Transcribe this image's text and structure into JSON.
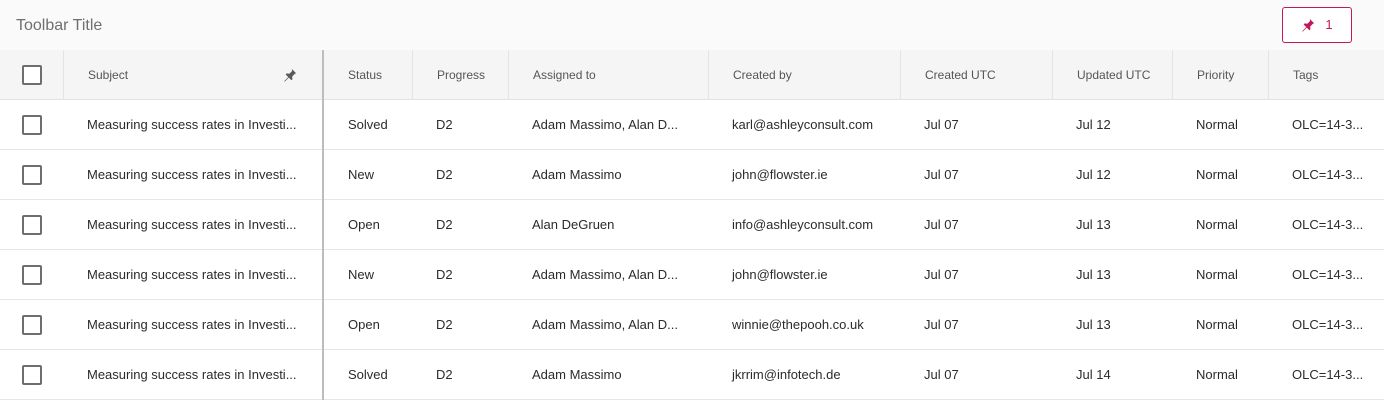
{
  "toolbar": {
    "title": "Toolbar Title",
    "pinned_count": "1",
    "accent_color": "#c2185b",
    "pin_icon": "pin-icon"
  },
  "columns": {
    "subject": "Subject",
    "status": "Status",
    "progress": "Progress",
    "assigned_to": "Assigned to",
    "created_by": "Created by",
    "created_utc": "Created UTC",
    "updated_utc": "Updated UTC",
    "priority": "Priority",
    "tags": "Tags"
  },
  "rows": [
    {
      "subject": "Measuring success rates in Investi...",
      "status": "Solved",
      "progress": "D2",
      "assigned_to": "Adam Massimo, Alan D...",
      "created_by": "karl@ashleyconsult.com",
      "created_utc": "Jul 07",
      "updated_utc": "Jul 12",
      "priority": "Normal",
      "tags": "OLC=14-3..."
    },
    {
      "subject": "Measuring success rates in Investi...",
      "status": "New",
      "progress": "D2",
      "assigned_to": "Adam Massimo",
      "created_by": "john@flowster.ie",
      "created_utc": "Jul 07",
      "updated_utc": "Jul 12",
      "priority": "Normal",
      "tags": "OLC=14-3..."
    },
    {
      "subject": "Measuring success rates in Investi...",
      "status": "Open",
      "progress": "D2",
      "assigned_to": "Alan DeGruen",
      "created_by": "info@ashleyconsult.com",
      "created_utc": "Jul 07",
      "updated_utc": "Jul 13",
      "priority": "Normal",
      "tags": "OLC=14-3..."
    },
    {
      "subject": "Measuring success rates in Investi...",
      "status": "New",
      "progress": "D2",
      "assigned_to": "Adam Massimo, Alan D...",
      "created_by": "john@flowster.ie",
      "created_utc": "Jul 07",
      "updated_utc": "Jul 13",
      "priority": "Normal",
      "tags": "OLC=14-3..."
    },
    {
      "subject": "Measuring success rates in Investi...",
      "status": "Open",
      "progress": "D2",
      "assigned_to": "Adam Massimo, Alan D...",
      "created_by": "winnie@thepooh.co.uk",
      "created_utc": "Jul 07",
      "updated_utc": "Jul 13",
      "priority": "Normal",
      "tags": "OLC=14-3..."
    },
    {
      "subject": "Measuring success rates in Investi...",
      "status": "Solved",
      "progress": "D2",
      "assigned_to": "Adam Massimo",
      "created_by": "jkrrim@infotech.de",
      "created_utc": "Jul 07",
      "updated_utc": "Jul 14",
      "priority": "Normal",
      "tags": "OLC=14-3..."
    }
  ]
}
